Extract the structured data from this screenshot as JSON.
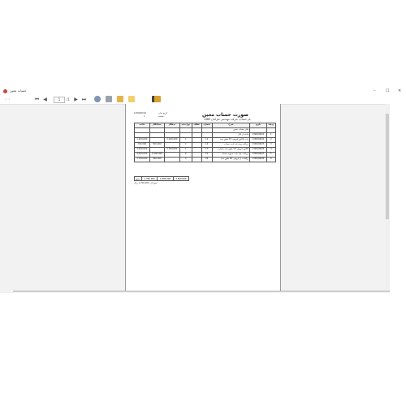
{
  "window": {
    "title": "حساب معین",
    "minimize": "–",
    "maximize": "☐",
    "close": "✕"
  },
  "toolbar": {
    "page_current": "1",
    "page_total": "/1",
    "zoom": "100%"
  },
  "report": {
    "title": "صورت حساب معین",
    "print_date_label": "تاریخ چاپ:",
    "print_date": "1399/06/10",
    "page_label": "صفحه:",
    "page_no": "1",
    "account_line": "نام حساب: شرکت مهندسی طراحان 1385",
    "subheading": "دفتر حساب معین",
    "headers": [
      "ردیف",
      "تاریخ",
      "شرح",
      "شماره",
      "عطف",
      "نوع سند",
      "بدهکار",
      "بستانکار",
      "مانده"
    ],
    "rows": [
      [
        "1",
        "1399/06/01",
        "مانده از قبل",
        "",
        "",
        "",
        "",
        "",
        ""
      ],
      [
        "2",
        "1399/06/02",
        "بابت فاکتور فروش کالا طبق سند",
        "12",
        "",
        "1",
        "1,200,000",
        "",
        "1,200,000"
      ],
      [
        "3",
        "1399/06/03",
        "دریافت وجه نقد بابت حساب",
        "14",
        "",
        "2",
        "",
        "500,000",
        "700,000"
      ],
      [
        "4",
        "1399/06/05",
        "فاکتور فروش کالا طبق سند شماره",
        "17",
        "",
        "1",
        "2,300,000",
        "",
        "3,000,000"
      ],
      [
        "5",
        "1399/06/07",
        "دریافت چک بابت تسویه حساب",
        "21",
        "",
        "2",
        "",
        "1,000,000",
        "2,000,000"
      ],
      [
        "6",
        "1399/06/09",
        "برگشت از فروش کالا طبق سند",
        "24",
        "",
        "3",
        "",
        "300,000",
        "1,700,000"
      ]
    ],
    "totals": {
      "label": "جمع",
      "debit": "3,500,000",
      "credit": "1,800,000",
      "balance": "1,700,000"
    },
    "footer_note": "جمع کل: 1,700,000 ریال"
  }
}
